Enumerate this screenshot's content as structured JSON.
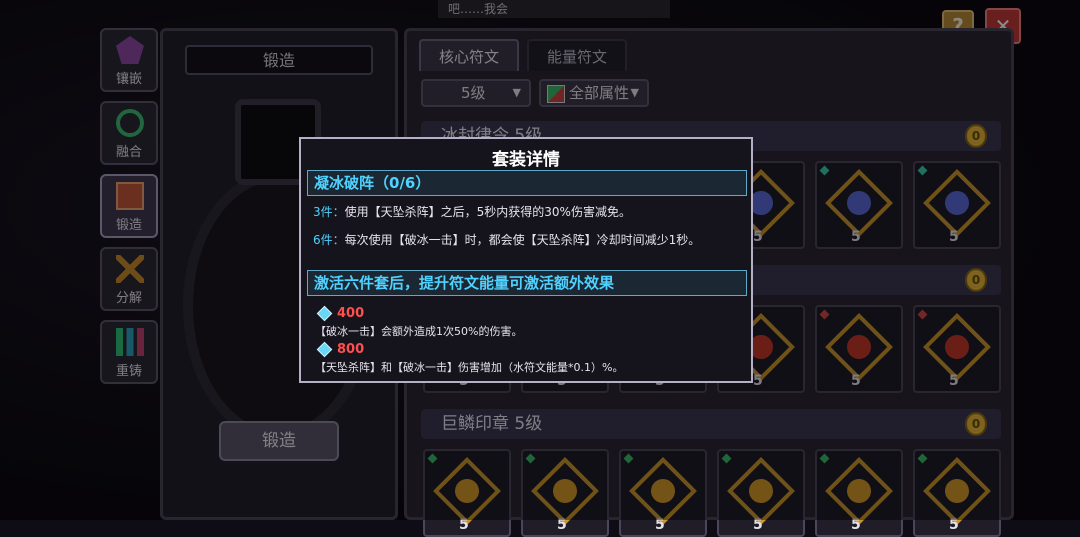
{
  "top_snippet": "吧……我会",
  "left_tabs": [
    {
      "label": "镶嵌",
      "icon": "inlay-icon",
      "color": "#c06ad4"
    },
    {
      "label": "融合",
      "icon": "fusion-icon",
      "color": "#3dbb72"
    },
    {
      "label": "锻造",
      "icon": "forge-icon",
      "color": "#d06040"
    },
    {
      "label": "分解",
      "icon": "decompose-icon",
      "color": "#c88a2a"
    },
    {
      "label": "重铸",
      "icon": "recast-icon",
      "color": "#2fc07a"
    }
  ],
  "forge": {
    "title": "锻造",
    "button": "锻造"
  },
  "tabs": {
    "active": "核心符文",
    "inactive": "能量符文"
  },
  "filters": {
    "level": "5级",
    "attribute": "全部属性"
  },
  "sets": [
    {
      "name": "冰封律令 5级",
      "gem_color": "#3fc9b0",
      "core_color": "#5a6ad8",
      "level": "5"
    },
    {
      "name": "",
      "gem_color": "#d04848",
      "core_color": "#c43828",
      "level": "5"
    },
    {
      "name": "巨鳞印章 5级",
      "gem_color": "#3fb86a",
      "core_color": "#d49a28",
      "level": "5"
    }
  ],
  "popup": {
    "title": "套装详情",
    "set_name": "凝冰破阵（0/6）",
    "bonus3_prefix": "3件：",
    "bonus3_text": "使用【天坠杀阵】之后，5秒内获得的30%伤害减免。",
    "bonus6_prefix": "6件：",
    "bonus6_text": "每次使用【破冰一击】时，都会使【天坠杀阵】冷却时间减少1秒。",
    "extra_header": "激活六件套后，提升符文能量可激活额外效果",
    "energy": [
      {
        "value": "400",
        "desc": "【破冰一击】会额外造成1次50%的伤害。"
      },
      {
        "value": "800",
        "desc": "【天坠杀阵】和【破冰一击】伤害增加（水符文能量*0.1）%。"
      }
    ]
  },
  "colors": {
    "accent_cyan": "#4fd2ff",
    "energy_red": "#ff4f4f"
  }
}
